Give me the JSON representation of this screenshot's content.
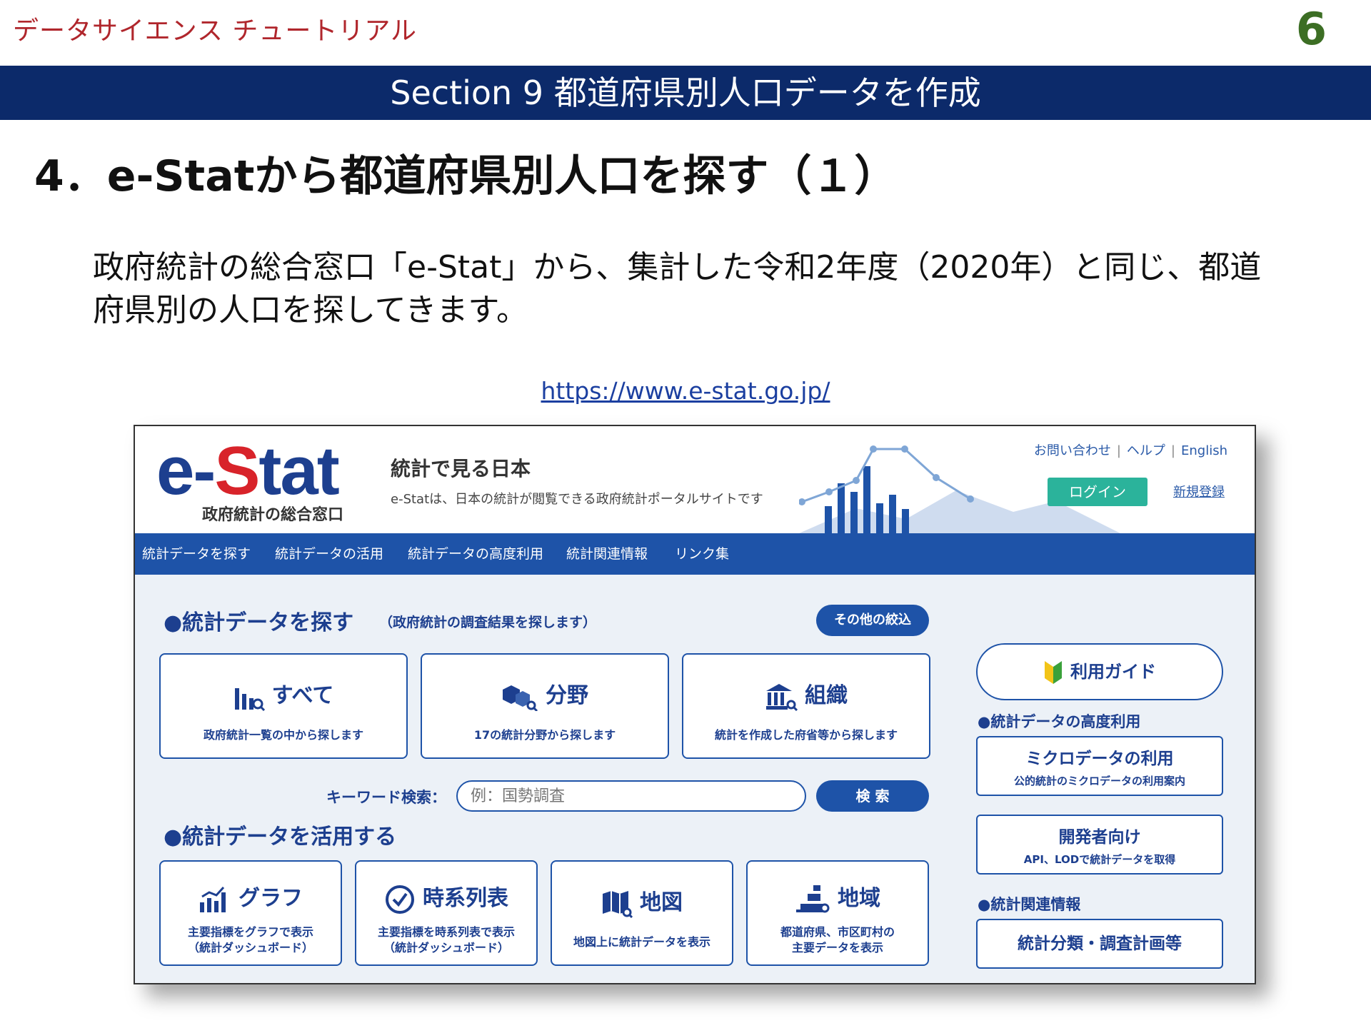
{
  "slide": {
    "brand": "データサイエンス チュートリアル",
    "page_number": "6",
    "section": "Section 9 都道府県別人口データを作成",
    "heading": "4．e-Statから都道府県別人口を探す（１）",
    "body": "政府統計の総合窓口「e-Stat」から、集計した令和2年度（2020年）と同じ、都道府県別の人口を探してきます。",
    "url": "https://www.e-stat.go.jp/"
  },
  "estat": {
    "logo_e": "e-",
    "logo_s": "S",
    "logo_tat": "tat",
    "logo_sub": "政府統計の総合窓口",
    "tagline_title": "統計で見る日本",
    "tagline_desc": "e-Statは、日本の統計が閲覧できる政府統計ポータルサイトです",
    "toplinks": [
      "お問い合わせ",
      "ヘルプ",
      "English"
    ],
    "login": "ログイン",
    "register": "新規登録",
    "nav": [
      "統計データを探す",
      "統計データの活用",
      "統計データの高度利用",
      "統計関連情報",
      "リンク集"
    ],
    "search_section": {
      "title": "●統計データを探す",
      "note": "（政府統計の調査結果を探します）",
      "more_filters": "その他の絞込",
      "cards": [
        {
          "title": "すべて",
          "desc": "政府統計一覧の中から探します",
          "icon": "bar-chart-search-icon"
        },
        {
          "title": "分野",
          "desc": "17の統計分野から探します",
          "icon": "boxes-search-icon"
        },
        {
          "title": "組織",
          "desc": "統計を作成した府省等から探します",
          "icon": "building-search-icon"
        }
      ],
      "keyword_label": "キーワード検索：",
      "keyword_placeholder": "例：国勢調査",
      "search_button": "検 索"
    },
    "use_section": {
      "title": "●統計データを活用する",
      "cards": [
        {
          "title": "グラフ",
          "desc1": "主要指標をグラフで表示",
          "desc2": "（統計ダッシュボード）",
          "icon": "graph-icon"
        },
        {
          "title": "時系列表",
          "desc1": "主要指標を時系列表で表示",
          "desc2": "（統計ダッシュボード）",
          "icon": "clock-icon"
        },
        {
          "title": "地図",
          "desc1": "地図上に統計データを表示",
          "desc2": "",
          "icon": "map-icon"
        },
        {
          "title": "地域",
          "desc1": "都道府県、市区町村の",
          "desc2": "主要データを表示",
          "icon": "region-icon"
        }
      ]
    },
    "side": {
      "guide": "利用ガイド",
      "advanced_heading": "●統計データの高度利用",
      "micro_title": "ミクロデータの利用",
      "micro_desc": "公的統計のミクロデータの利用案内",
      "dev_title": "開発者向け",
      "dev_desc": "API、LODで統計データを取得",
      "related_heading": "●統計関連情報",
      "classification": "統計分類・調査計画等"
    }
  }
}
